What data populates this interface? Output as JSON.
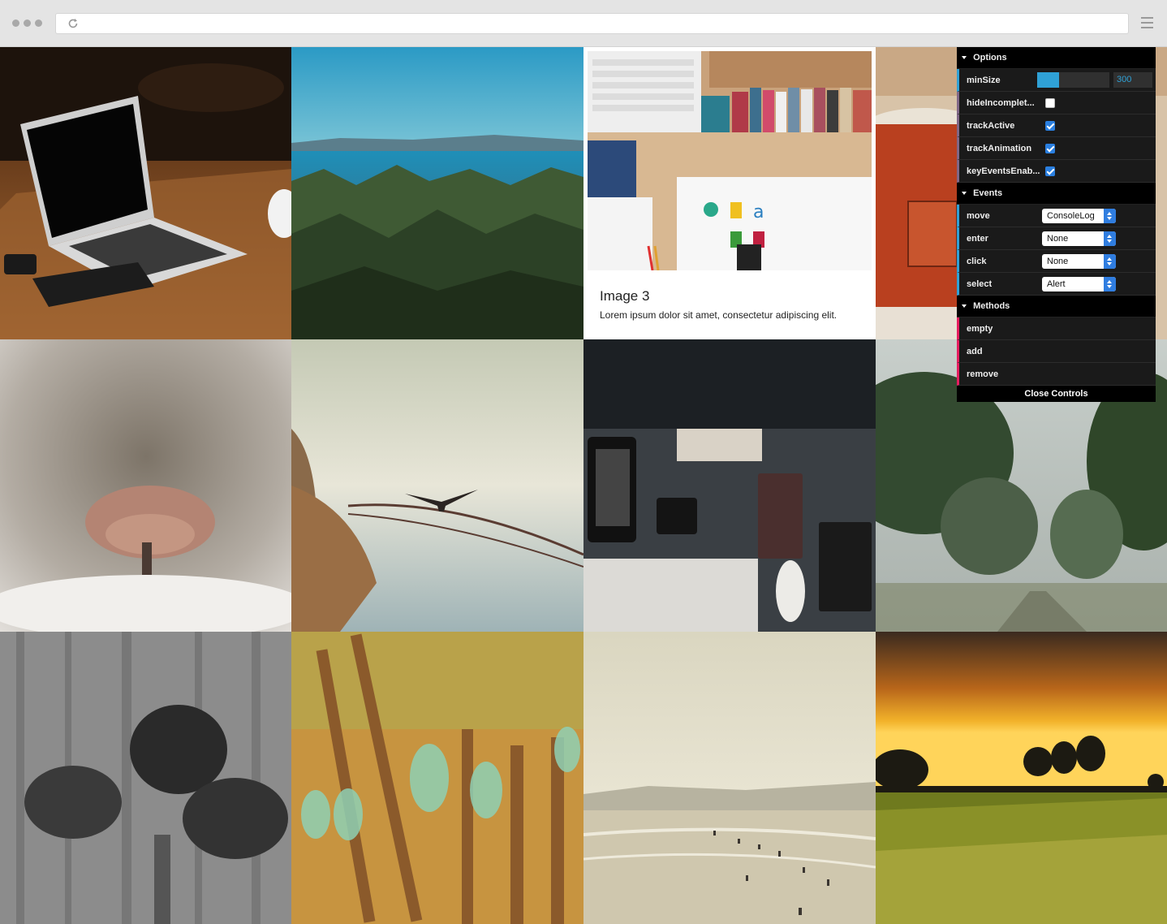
{
  "browser": {
    "url": "",
    "icons": [
      "reload-icon",
      "hamburger-menu-icon"
    ]
  },
  "gallery": {
    "active_tile": {
      "title": "Image 3",
      "text": "Lorem ipsum dolor sit amet, consectetur adipiscing elit."
    }
  },
  "controls": {
    "options": {
      "title": "Options",
      "minsize_label": "minSize",
      "minsize_value": "300",
      "minsize_fraction": 0.3,
      "hide_label": "hideIncomplet...",
      "hide_checked": false,
      "trackactive_label": "trackActive",
      "trackactive_checked": true,
      "trackanimation_label": "trackAnimation",
      "trackanimation_checked": true,
      "keyevents_label": "keyEventsEnab...",
      "keyevents_checked": true
    },
    "events": {
      "title": "Events",
      "move_label": "move",
      "move_value": "ConsoleLog",
      "enter_label": "enter",
      "enter_value": "None",
      "click_label": "click",
      "click_value": "None",
      "select_label": "select",
      "select_value": "Alert"
    },
    "methods": {
      "title": "Methods",
      "empty_label": "empty",
      "add_label": "add",
      "remove_label": "remove"
    },
    "close_label": "Close Controls"
  },
  "colors": {
    "number_accent": "#2fa1d6",
    "bool_accent": "#806787",
    "function_accent": "#e61d5f",
    "panel_bg": "#1a1a1a"
  }
}
